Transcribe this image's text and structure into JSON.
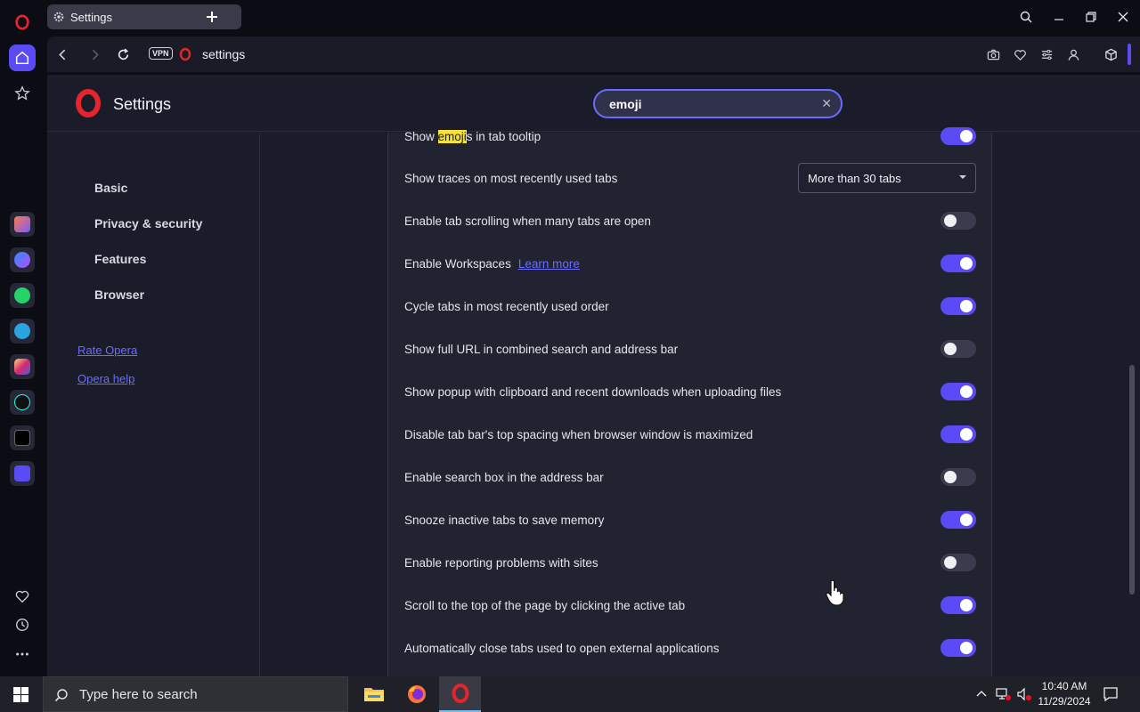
{
  "tab": {
    "title": "Settings"
  },
  "toolbar": {
    "vpn_label": "VPN",
    "url": "settings"
  },
  "settings": {
    "title": "Settings",
    "search_value": "emoji"
  },
  "nav": {
    "items": [
      {
        "label": "Basic"
      },
      {
        "label": "Privacy & security"
      },
      {
        "label": "Features"
      },
      {
        "label": "Browser"
      }
    ],
    "links": [
      {
        "label": "Rate Opera"
      },
      {
        "label": "Opera help"
      }
    ]
  },
  "rows": [
    {
      "pre": "Show ",
      "highlight": "emoji",
      "post": "s in tab tooltip",
      "type": "toggle",
      "on": true
    },
    {
      "label": "Show traces on most recently used tabs",
      "type": "select",
      "value": "More than 30 tabs"
    },
    {
      "label": "Enable tab scrolling when many tabs are open",
      "type": "toggle",
      "on": false
    },
    {
      "label": "Enable Workspaces",
      "link": "Learn more",
      "type": "toggle",
      "on": true
    },
    {
      "label": "Cycle tabs in most recently used order",
      "type": "toggle",
      "on": true
    },
    {
      "label": "Show full URL in combined search and address bar",
      "type": "toggle",
      "on": false
    },
    {
      "label": "Show popup with clipboard and recent downloads when uploading files",
      "type": "toggle",
      "on": true
    },
    {
      "label": "Disable tab bar's top spacing when browser window is maximized",
      "type": "toggle",
      "on": true
    },
    {
      "label": "Enable search box in the address bar",
      "type": "toggle",
      "on": false
    },
    {
      "label": "Snooze inactive tabs to save memory",
      "type": "toggle",
      "on": true
    },
    {
      "label": "Enable reporting problems with sites",
      "type": "toggle",
      "on": false
    },
    {
      "label": "Scroll to the top of the page by clicking the active tab",
      "type": "toggle",
      "on": true
    },
    {
      "label": "Automatically close tabs used to open external applications",
      "type": "toggle",
      "on": true
    }
  ],
  "taskbar": {
    "search_placeholder": "Type here to search",
    "time": "10:40 AM",
    "date": "11/29/2024"
  },
  "colors": {
    "accent": "#5a4bf5",
    "opera_red": "#e5242b",
    "highlight": "#f5e23a"
  }
}
